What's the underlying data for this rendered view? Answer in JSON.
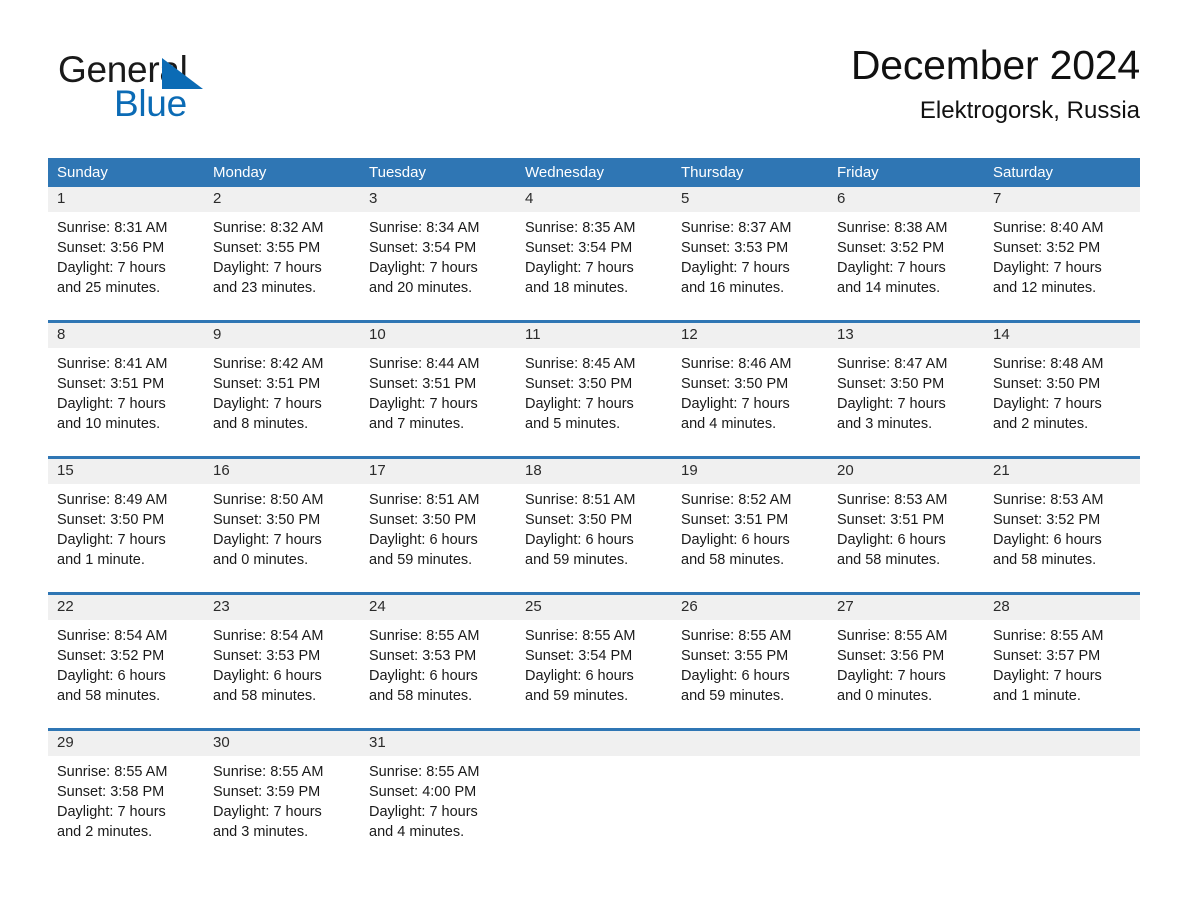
{
  "brand": {
    "name_part1": "General",
    "name_part2": "Blue",
    "mark": "triangle-logo-icon",
    "color_dark": "#1a1a1a",
    "color_blue": "#0b6bb5"
  },
  "header": {
    "title": "December 2024",
    "location": "Elektrogorsk, Russia"
  },
  "theme": {
    "header_blue": "#2f76b4",
    "daynum_band": "#f0f0f0",
    "rule_blue": "#2f76b4",
    "text": "#1a1a1a"
  },
  "weekdays": [
    "Sunday",
    "Monday",
    "Tuesday",
    "Wednesday",
    "Thursday",
    "Friday",
    "Saturday"
  ],
  "weeks": [
    [
      {
        "day": "1",
        "sunrise": "Sunrise: 8:31 AM",
        "sunset": "Sunset: 3:56 PM",
        "daylight1": "Daylight: 7 hours",
        "daylight2": "and 25 minutes."
      },
      {
        "day": "2",
        "sunrise": "Sunrise: 8:32 AM",
        "sunset": "Sunset: 3:55 PM",
        "daylight1": "Daylight: 7 hours",
        "daylight2": "and 23 minutes."
      },
      {
        "day": "3",
        "sunrise": "Sunrise: 8:34 AM",
        "sunset": "Sunset: 3:54 PM",
        "daylight1": "Daylight: 7 hours",
        "daylight2": "and 20 minutes."
      },
      {
        "day": "4",
        "sunrise": "Sunrise: 8:35 AM",
        "sunset": "Sunset: 3:54 PM",
        "daylight1": "Daylight: 7 hours",
        "daylight2": "and 18 minutes."
      },
      {
        "day": "5",
        "sunrise": "Sunrise: 8:37 AM",
        "sunset": "Sunset: 3:53 PM",
        "daylight1": "Daylight: 7 hours",
        "daylight2": "and 16 minutes."
      },
      {
        "day": "6",
        "sunrise": "Sunrise: 8:38 AM",
        "sunset": "Sunset: 3:52 PM",
        "daylight1": "Daylight: 7 hours",
        "daylight2": "and 14 minutes."
      },
      {
        "day": "7",
        "sunrise": "Sunrise: 8:40 AM",
        "sunset": "Sunset: 3:52 PM",
        "daylight1": "Daylight: 7 hours",
        "daylight2": "and 12 minutes."
      }
    ],
    [
      {
        "day": "8",
        "sunrise": "Sunrise: 8:41 AM",
        "sunset": "Sunset: 3:51 PM",
        "daylight1": "Daylight: 7 hours",
        "daylight2": "and 10 minutes."
      },
      {
        "day": "9",
        "sunrise": "Sunrise: 8:42 AM",
        "sunset": "Sunset: 3:51 PM",
        "daylight1": "Daylight: 7 hours",
        "daylight2": "and 8 minutes."
      },
      {
        "day": "10",
        "sunrise": "Sunrise: 8:44 AM",
        "sunset": "Sunset: 3:51 PM",
        "daylight1": "Daylight: 7 hours",
        "daylight2": "and 7 minutes."
      },
      {
        "day": "11",
        "sunrise": "Sunrise: 8:45 AM",
        "sunset": "Sunset: 3:50 PM",
        "daylight1": "Daylight: 7 hours",
        "daylight2": "and 5 minutes."
      },
      {
        "day": "12",
        "sunrise": "Sunrise: 8:46 AM",
        "sunset": "Sunset: 3:50 PM",
        "daylight1": "Daylight: 7 hours",
        "daylight2": "and 4 minutes."
      },
      {
        "day": "13",
        "sunrise": "Sunrise: 8:47 AM",
        "sunset": "Sunset: 3:50 PM",
        "daylight1": "Daylight: 7 hours",
        "daylight2": "and 3 minutes."
      },
      {
        "day": "14",
        "sunrise": "Sunrise: 8:48 AM",
        "sunset": "Sunset: 3:50 PM",
        "daylight1": "Daylight: 7 hours",
        "daylight2": "and 2 minutes."
      }
    ],
    [
      {
        "day": "15",
        "sunrise": "Sunrise: 8:49 AM",
        "sunset": "Sunset: 3:50 PM",
        "daylight1": "Daylight: 7 hours",
        "daylight2": "and 1 minute."
      },
      {
        "day": "16",
        "sunrise": "Sunrise: 8:50 AM",
        "sunset": "Sunset: 3:50 PM",
        "daylight1": "Daylight: 7 hours",
        "daylight2": "and 0 minutes."
      },
      {
        "day": "17",
        "sunrise": "Sunrise: 8:51 AM",
        "sunset": "Sunset: 3:50 PM",
        "daylight1": "Daylight: 6 hours",
        "daylight2": "and 59 minutes."
      },
      {
        "day": "18",
        "sunrise": "Sunrise: 8:51 AM",
        "sunset": "Sunset: 3:50 PM",
        "daylight1": "Daylight: 6 hours",
        "daylight2": "and 59 minutes."
      },
      {
        "day": "19",
        "sunrise": "Sunrise: 8:52 AM",
        "sunset": "Sunset: 3:51 PM",
        "daylight1": "Daylight: 6 hours",
        "daylight2": "and 58 minutes."
      },
      {
        "day": "20",
        "sunrise": "Sunrise: 8:53 AM",
        "sunset": "Sunset: 3:51 PM",
        "daylight1": "Daylight: 6 hours",
        "daylight2": "and 58 minutes."
      },
      {
        "day": "21",
        "sunrise": "Sunrise: 8:53 AM",
        "sunset": "Sunset: 3:52 PM",
        "daylight1": "Daylight: 6 hours",
        "daylight2": "and 58 minutes."
      }
    ],
    [
      {
        "day": "22",
        "sunrise": "Sunrise: 8:54 AM",
        "sunset": "Sunset: 3:52 PM",
        "daylight1": "Daylight: 6 hours",
        "daylight2": "and 58 minutes."
      },
      {
        "day": "23",
        "sunrise": "Sunrise: 8:54 AM",
        "sunset": "Sunset: 3:53 PM",
        "daylight1": "Daylight: 6 hours",
        "daylight2": "and 58 minutes."
      },
      {
        "day": "24",
        "sunrise": "Sunrise: 8:55 AM",
        "sunset": "Sunset: 3:53 PM",
        "daylight1": "Daylight: 6 hours",
        "daylight2": "and 58 minutes."
      },
      {
        "day": "25",
        "sunrise": "Sunrise: 8:55 AM",
        "sunset": "Sunset: 3:54 PM",
        "daylight1": "Daylight: 6 hours",
        "daylight2": "and 59 minutes."
      },
      {
        "day": "26",
        "sunrise": "Sunrise: 8:55 AM",
        "sunset": "Sunset: 3:55 PM",
        "daylight1": "Daylight: 6 hours",
        "daylight2": "and 59 minutes."
      },
      {
        "day": "27",
        "sunrise": "Sunrise: 8:55 AM",
        "sunset": "Sunset: 3:56 PM",
        "daylight1": "Daylight: 7 hours",
        "daylight2": "and 0 minutes."
      },
      {
        "day": "28",
        "sunrise": "Sunrise: 8:55 AM",
        "sunset": "Sunset: 3:57 PM",
        "daylight1": "Daylight: 7 hours",
        "daylight2": "and 1 minute."
      }
    ],
    [
      {
        "day": "29",
        "sunrise": "Sunrise: 8:55 AM",
        "sunset": "Sunset: 3:58 PM",
        "daylight1": "Daylight: 7 hours",
        "daylight2": "and 2 minutes."
      },
      {
        "day": "30",
        "sunrise": "Sunrise: 8:55 AM",
        "sunset": "Sunset: 3:59 PM",
        "daylight1": "Daylight: 7 hours",
        "daylight2": "and 3 minutes."
      },
      {
        "day": "31",
        "sunrise": "Sunrise: 8:55 AM",
        "sunset": "Sunset: 4:00 PM",
        "daylight1": "Daylight: 7 hours",
        "daylight2": "and 4 minutes."
      },
      {
        "day": "",
        "sunrise": "",
        "sunset": "",
        "daylight1": "",
        "daylight2": ""
      },
      {
        "day": "",
        "sunrise": "",
        "sunset": "",
        "daylight1": "",
        "daylight2": ""
      },
      {
        "day": "",
        "sunrise": "",
        "sunset": "",
        "daylight1": "",
        "daylight2": ""
      },
      {
        "day": "",
        "sunrise": "",
        "sunset": "",
        "daylight1": "",
        "daylight2": ""
      }
    ]
  ]
}
